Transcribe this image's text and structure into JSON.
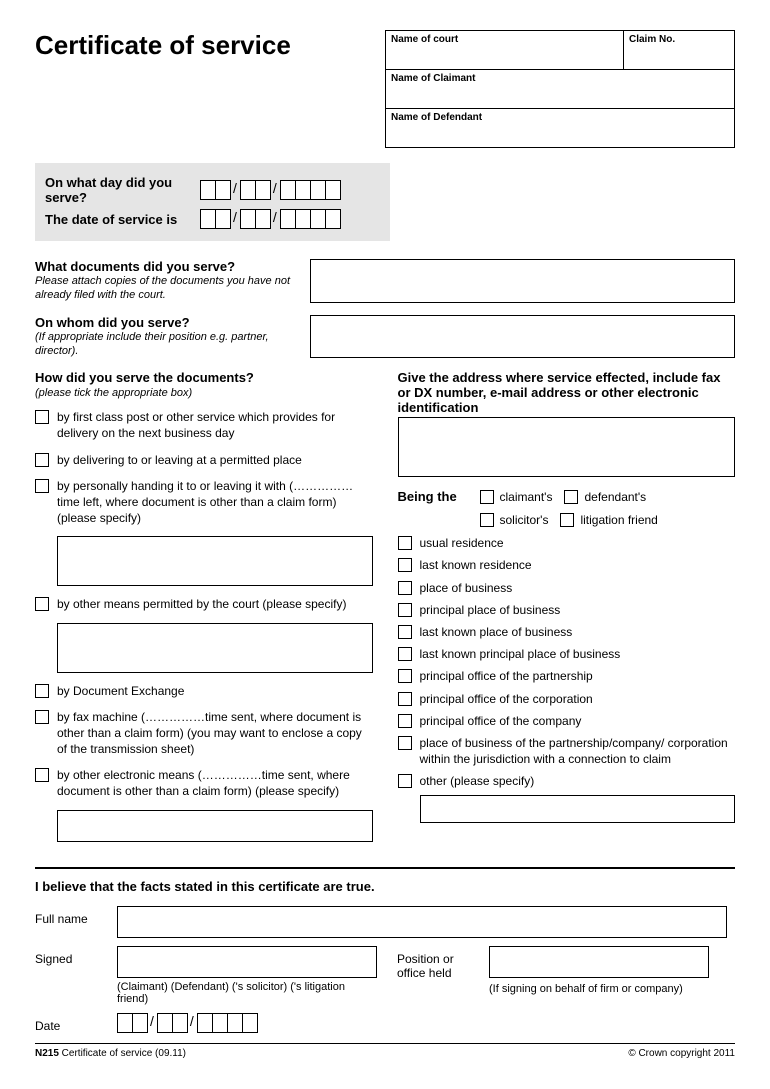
{
  "title": "Certificate of service",
  "court": {
    "name_label": "Name of court",
    "claim_label": "Claim No.",
    "claimant_label": "Name of Claimant",
    "defendant_label": "Name of Defendant"
  },
  "dates": {
    "serve_label": "On what day did you serve?",
    "service_label": "The date of service is"
  },
  "q1": {
    "label": "What documents did you serve?",
    "hint": "Please attach copies of the documents you have not already filed with the court."
  },
  "q2": {
    "label": "On whom did you serve?",
    "hint": "(If appropriate include their position e.g. partner, director)."
  },
  "how": {
    "head": "How did you serve the documents?",
    "hint": "(please tick the appropriate box)",
    "opts": [
      "by first class post or other service which provides for delivery on the next business day",
      "by delivering to or leaving at a permitted place",
      "by personally handing it to or leaving it with (……………time left, where document is other than a claim form) (please specify)",
      "by other means permitted by the court (please specify)",
      "by Document Exchange",
      "by fax machine (……………time sent, where document is other than a claim form) (you may want to enclose a copy of the transmission sheet)",
      "by other electronic means (……………time sent, where document is other than a claim form) (please specify)"
    ]
  },
  "addr": {
    "head": "Give the address where service effected, include fax or DX number, e-mail address or other electronic identification",
    "being": "Being the",
    "roles": [
      "claimant's",
      "defendant's",
      "solicitor's",
      "litigation friend"
    ],
    "places": [
      "usual residence",
      "last known residence",
      "place of business",
      "principal place of business",
      "last known place of business",
      "last known principal place of business",
      "principal office of the partnership",
      "principal office of the corporation",
      "principal office of the company",
      "place of business of the partnership/company/ corporation within the jurisdiction with a connection to claim",
      "other (please specify)"
    ]
  },
  "believe": "I believe that the facts stated in this certificate are true.",
  "sig": {
    "fullname": "Full name",
    "signed": "Signed",
    "position": "Position or office held",
    "date": "Date",
    "sub1": "(Claimant) (Defendant) ('s solicitor) ('s litigation friend)",
    "sub2": "(If signing on behalf of firm or company)"
  },
  "footer": {
    "code": "N215",
    "desc": " Certificate of service (09.11)",
    "copyright": "© Crown copyright 2011"
  }
}
